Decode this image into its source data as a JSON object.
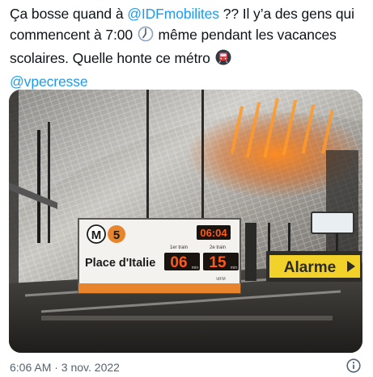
{
  "tweet": {
    "text_part1": "Ça bosse quand à ",
    "mention1": "@IDFmobilites",
    "text_part2": " ?? Il y’a des gens qui commencent à 7:00 ",
    "emoji1": "clock-seven-icon",
    "text_part3": " même pendant les vacances scolaires. Quelle honte ce métro ",
    "emoji2": "metro-icon",
    "mention2": "@vpecresse",
    "timestamp": "6:06 AM · 3 nov. 2022"
  },
  "photo": {
    "line_badge_letter": "M",
    "line_number": "5",
    "clock_display": "06:04",
    "station": "Place d'Italie",
    "first_train_label": "1er train",
    "second_train_label": "2e train",
    "first_train_minutes": "06",
    "second_train_minutes": "15",
    "minutes_unit": "min",
    "alarm_sign": "Alarme",
    "operator_logo": "IdFM",
    "colors": {
      "metro_orange": "#e8842c",
      "led_orange": "#ff5a1a",
      "alarm_yellow": "#f2d22a",
      "mention_blue": "#1d9bf0"
    }
  },
  "icons": {
    "info": "info-circle-icon"
  }
}
